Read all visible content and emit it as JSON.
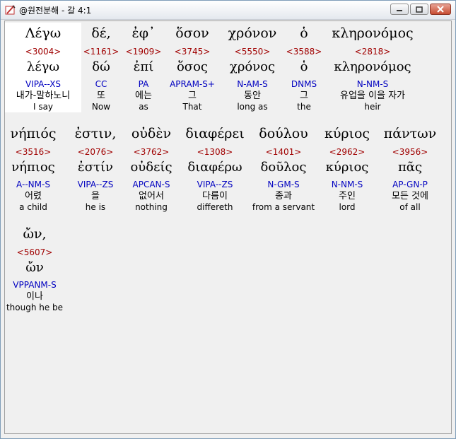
{
  "window": {
    "title": "@원전분해 - 갈 4:1",
    "icon": "bible-app-icon"
  },
  "rows": [
    [
      {
        "greek": "Λέγω",
        "strong": "<3004>",
        "lemma": "λέγω",
        "morph": "VIPA--XS",
        "korean": "내가-말하노니",
        "english": "I say"
      },
      {
        "greek": "δέ,",
        "strong": "<1161>",
        "lemma": "δώ",
        "morph": "CC",
        "korean": "또",
        "english": "Now"
      },
      {
        "greek": "ἐφ᾽",
        "strong": "<1909>",
        "lemma": "ἐπί",
        "morph": "PA",
        "korean": "에는",
        "english": "as"
      },
      {
        "greek": "ὅσον",
        "strong": "<3745>",
        "lemma": "ὅσος",
        "morph": "APRAM-S+",
        "korean": "그",
        "english": "That"
      },
      {
        "greek": "χρόνον",
        "strong": "<5550>",
        "lemma": "χρόνος",
        "morph": "N-AM-S",
        "korean": "동안",
        "english": "long as"
      },
      {
        "greek": "ὁ",
        "strong": "<3588>",
        "lemma": "ὁ",
        "morph": "DNMS",
        "korean": "그",
        "english": "the"
      },
      {
        "greek": "κληρονόμος",
        "strong": "<2818>",
        "lemma": "κληρονόμος",
        "morph": "N-NM-S",
        "korean": "유업을 이을 자가",
        "english": "heir"
      }
    ],
    [
      {
        "greek": "νήπιός",
        "strong": "<3516>",
        "lemma": "νήπιος",
        "morph": "A--NM-S",
        "korean": "어렸",
        "english": "a child"
      },
      {
        "greek": "ἐστιν,",
        "strong": "<2076>",
        "lemma": "ἐστίν",
        "morph": "VIPA--ZS",
        "korean": "을",
        "english": "he is"
      },
      {
        "greek": "οὐδὲν",
        "strong": "<3762>",
        "lemma": "οὐδείς",
        "morph": "APCAN-S",
        "korean": "없어서",
        "english": "nothing"
      },
      {
        "greek": "διαφέρει",
        "strong": "<1308>",
        "lemma": "διαφέρω",
        "morph": "VIPA--ZS",
        "korean": "다름이",
        "english": "differeth"
      },
      {
        "greek": "δούλου",
        "strong": "<1401>",
        "lemma": "δοῦλος",
        "morph": "N-GM-S",
        "korean": "종과",
        "english": "from a servant"
      },
      {
        "greek": "κύριος",
        "strong": "<2962>",
        "lemma": "κύριος",
        "morph": "N-NM-S",
        "korean": "주인",
        "english": "lord"
      },
      {
        "greek": "πάντων",
        "strong": "<3956>",
        "lemma": "πᾶς",
        "morph": "AP-GN-P",
        "korean": "모든 것에",
        "english": "of all"
      }
    ],
    [
      {
        "greek": "ὤν,",
        "strong": "<5607>",
        "lemma": "ὤν",
        "morph": "VPPANM-S",
        "korean": "이나",
        "english": "though he be"
      }
    ]
  ]
}
